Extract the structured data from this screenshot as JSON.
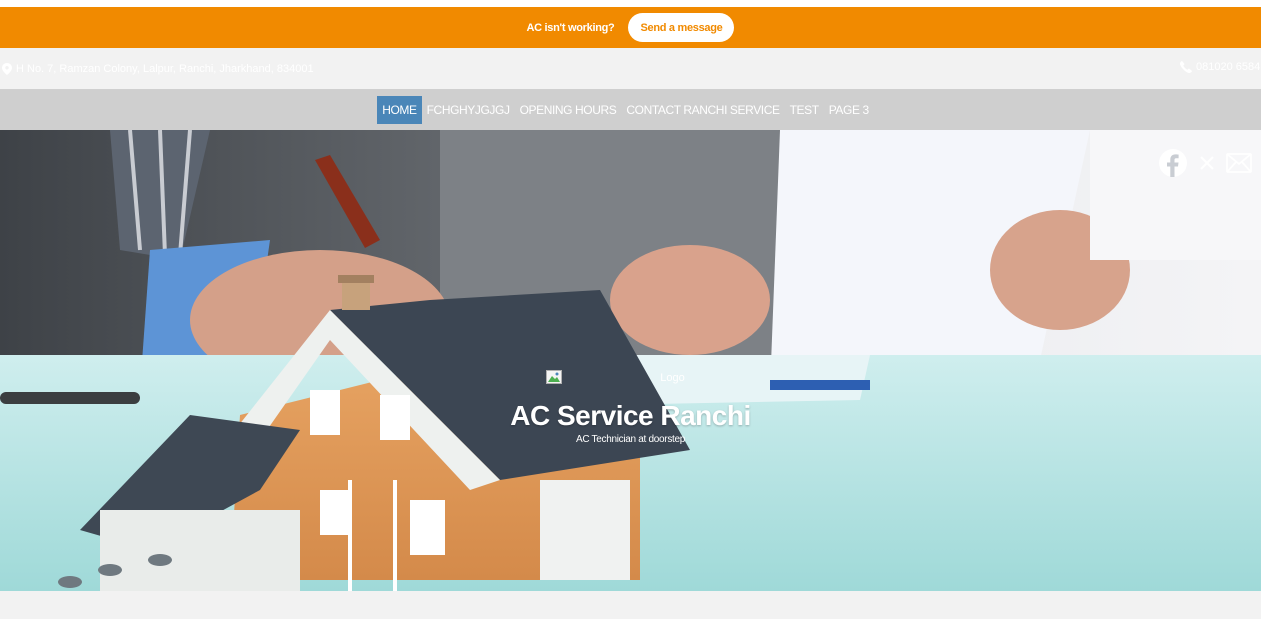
{
  "promo": {
    "text": "AC isn't working?",
    "button_label": "Send a message"
  },
  "contact": {
    "address": "H No. 7, Ramzan Colony, Lalpur, Ranchi, Jharkhand, 834001",
    "phone": "081020 6584",
    "address_icon": "map-pin-icon",
    "phone_icon": "phone-icon"
  },
  "nav": {
    "items": [
      {
        "label": "HOME",
        "active": true
      },
      {
        "label": "FCHGHYJGJGJ",
        "active": false
      },
      {
        "label": "OPENING HOURS",
        "active": false
      },
      {
        "label": "CONTACT RANCHI SERVICE",
        "active": false
      },
      {
        "label": "TEST",
        "active": false
      },
      {
        "label": "PAGE 3",
        "active": false
      }
    ]
  },
  "social": {
    "icons": [
      "facebook-icon",
      "x-icon",
      "email-icon"
    ]
  },
  "brand": {
    "logo_alt": "Logo",
    "title": "AC Service Ranchi",
    "tagline": "AC Technician at doorstep"
  },
  "colors": {
    "promo_bg": "#f18a00",
    "nav_active": "#4a86b8",
    "nav_bg": "#cfcfcf",
    "info_bg": "#f2f2f2"
  }
}
